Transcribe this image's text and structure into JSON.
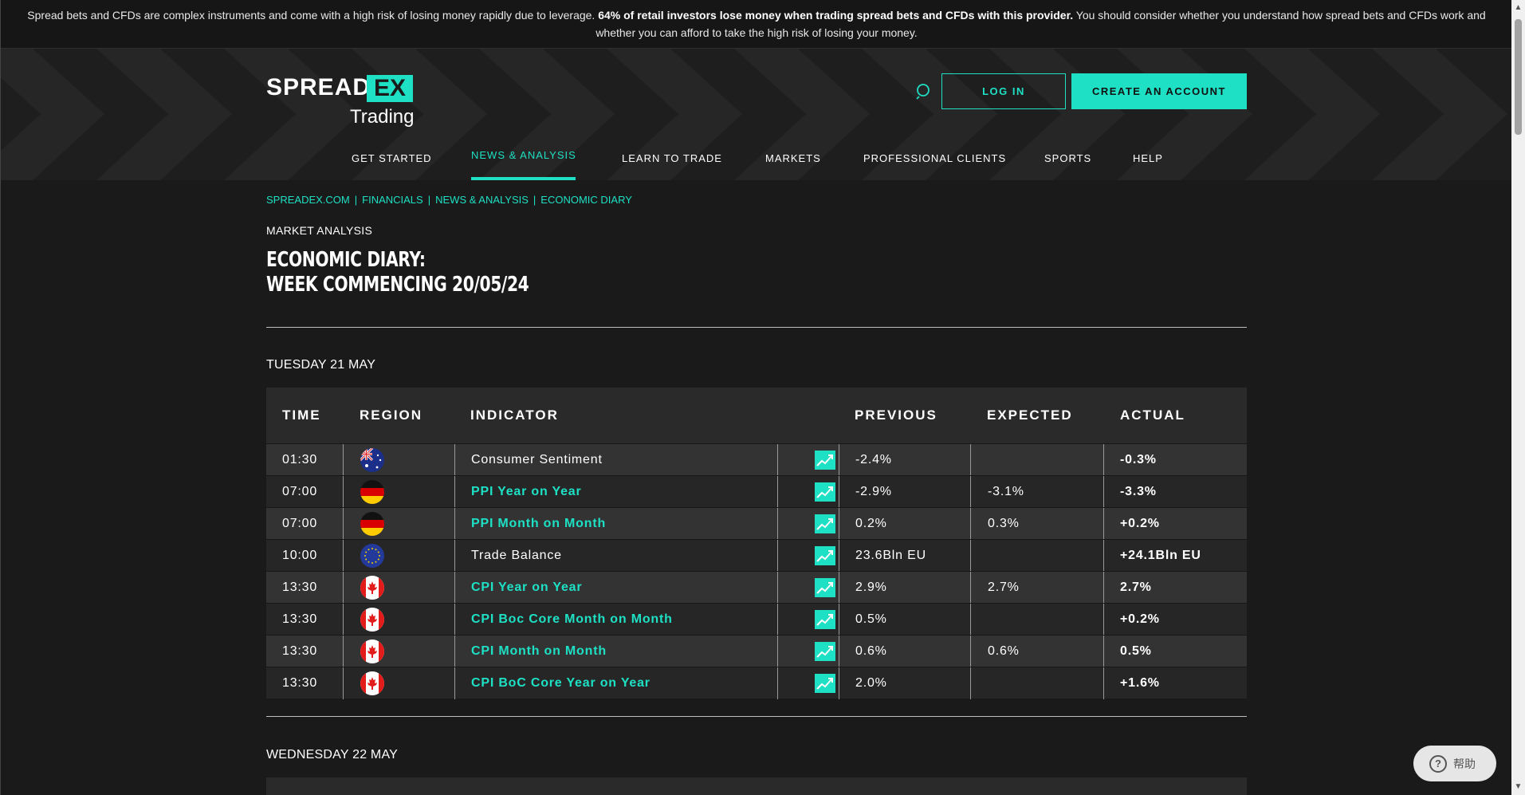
{
  "risk_banner": {
    "part1": "Spread bets and CFDs are complex instruments and come with a high risk of losing money rapidly due to leverage. ",
    "bold": "64% of retail investors lose money when trading spread bets and CFDs with this provider.",
    "part2": " You should consider whether you understand how spread bets and CFDs work and whether you can afford to take the high risk of losing your money."
  },
  "logo": {
    "spread": "SPREAD",
    "ex": "EX",
    "trading": "Trading"
  },
  "header": {
    "login_label": "LOG IN",
    "create_label": "CREATE AN ACCOUNT"
  },
  "nav": [
    {
      "label": "GET STARTED"
    },
    {
      "label": "NEWS & ANALYSIS",
      "active": true
    },
    {
      "label": "LEARN TO TRADE"
    },
    {
      "label": "MARKETS"
    },
    {
      "label": "PROFESSIONAL CLIENTS"
    },
    {
      "label": "SPORTS"
    },
    {
      "label": "HELP"
    }
  ],
  "breadcrumb": [
    "SPREADEX.COM",
    "FINANCIALS",
    "NEWS & ANALYSIS",
    "ECONOMIC DIARY"
  ],
  "kicker": "MARKET ANALYSIS",
  "title_line1": "ECONOMIC DIARY:",
  "title_line2": "WEEK COMMENCING 20/05/24",
  "days": [
    {
      "heading": "TUESDAY 21 MAY"
    },
    {
      "heading": "WEDNESDAY 22 MAY"
    }
  ],
  "table": {
    "headers": {
      "time": "TIME",
      "region": "REGION",
      "indicator": "INDICATOR",
      "previous": "PREVIOUS",
      "expected": "EXPECTED",
      "actual": "ACTUAL"
    },
    "rows": [
      {
        "time": "01:30",
        "region": "australia",
        "indicator": "Consumer Sentiment",
        "link": false,
        "previous": "-2.4%",
        "expected": "",
        "actual": "-0.3%"
      },
      {
        "time": "07:00",
        "region": "germany",
        "indicator": "PPI Year on Year",
        "link": true,
        "previous": "-2.9%",
        "expected": "-3.1%",
        "actual": "-3.3%"
      },
      {
        "time": "07:00",
        "region": "germany",
        "indicator": "PPI Month on Month",
        "link": true,
        "previous": "0.2%",
        "expected": "0.3%",
        "actual": "+0.2%"
      },
      {
        "time": "10:00",
        "region": "eu",
        "indicator": "Trade Balance",
        "link": false,
        "previous": "23.6Bln EU",
        "expected": "",
        "actual": "+24.1Bln EU"
      },
      {
        "time": "13:30",
        "region": "canada",
        "indicator": "CPI Year on Year",
        "link": true,
        "previous": "2.9%",
        "expected": "2.7%",
        "actual": "2.7%"
      },
      {
        "time": "13:30",
        "region": "canada",
        "indicator": "CPI Boc Core Month on Month",
        "link": true,
        "previous": "0.5%",
        "expected": "",
        "actual": "+0.2%"
      },
      {
        "time": "13:30",
        "region": "canada",
        "indicator": "CPI Month on Month",
        "link": true,
        "previous": "0.6%",
        "expected": "0.6%",
        "actual": "0.5%"
      },
      {
        "time": "13:30",
        "region": "canada",
        "indicator": "CPI BoC Core Year on Year",
        "link": true,
        "previous": "2.0%",
        "expected": "",
        "actual": "+1.6%"
      }
    ]
  },
  "help_button": {
    "label": "帮助"
  },
  "colors": {
    "accent": "#1ee0c4",
    "background": "#1a1a1a",
    "row_odd": "#333333",
    "row_even": "#262626"
  }
}
